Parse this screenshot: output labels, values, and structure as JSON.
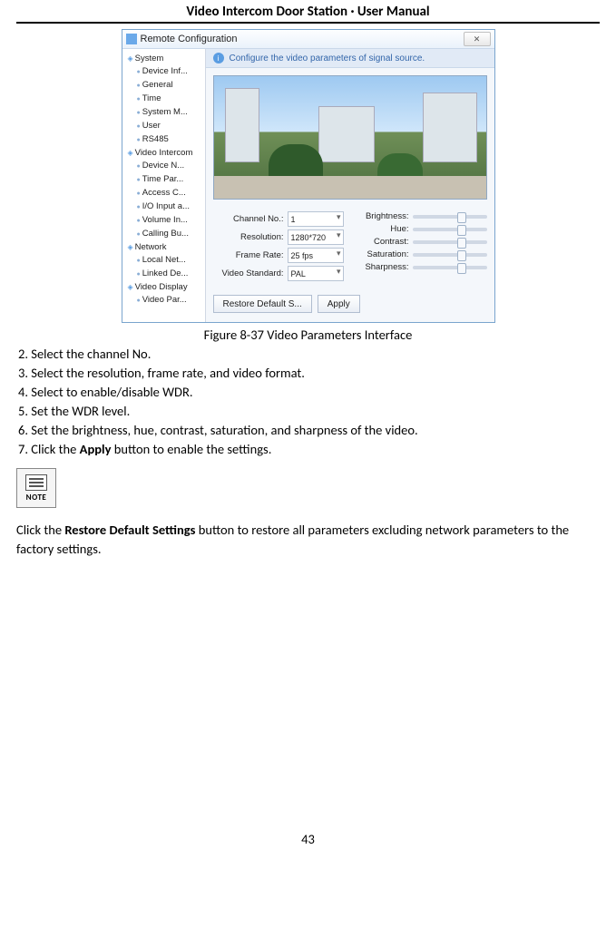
{
  "header": {
    "title": "Video Intercom Door Station · User Manual"
  },
  "screenshot": {
    "window_title": "Remote Configuration",
    "close_glyph": "✕",
    "hint_text": "Configure the video parameters of signal source.",
    "tree": {
      "roots": [
        {
          "label": "System",
          "children": [
            "Device Inf...",
            "General",
            "Time",
            "System M...",
            "User",
            "RS485"
          ]
        },
        {
          "label": "Video Intercom",
          "children": [
            "Device N...",
            "Time Par...",
            "Access C...",
            "I/O Input a...",
            "Volume In...",
            "Calling Bu..."
          ]
        },
        {
          "label": "Network",
          "children": [
            "Local Net...",
            "Linked De..."
          ]
        },
        {
          "label": "Video Display",
          "children": [
            "Video Par..."
          ]
        }
      ]
    },
    "left_params": [
      {
        "label": "Channel No.:",
        "value": "1"
      },
      {
        "label": "Resolution:",
        "value": "1280*720"
      },
      {
        "label": "Frame Rate:",
        "value": "25 fps"
      },
      {
        "label": "Video Standard:",
        "value": "PAL"
      }
    ],
    "right_params": [
      {
        "label": "Brightness:"
      },
      {
        "label": "Hue:"
      },
      {
        "label": "Contrast:"
      },
      {
        "label": "Saturation:"
      },
      {
        "label": "Sharpness:"
      }
    ],
    "buttons": {
      "restore": "Restore Default S...",
      "apply": "Apply"
    }
  },
  "caption": "Figure 8-37 Video Parameters Interface",
  "steps": [
    "2. Select the channel No.",
    "3. Select the resolution, frame rate, and video format.",
    "4. Select to enable/disable WDR.",
    "5. Set the WDR level.",
    "6. Set the brightness, hue, contrast, saturation, and sharpness of the video.",
    "7. Click the <b>Apply</b> button to enable the settings."
  ],
  "note_label": "NOTE",
  "note_text": "Click the <b>Restore Default Settings</b> button to restore all parameters excluding network parameters to the factory settings.",
  "page_number": "43"
}
